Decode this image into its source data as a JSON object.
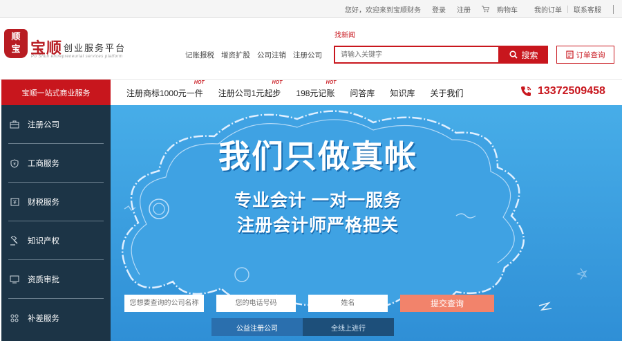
{
  "topbar": {
    "greeting": "您好，欢迎来到宝顺财务",
    "login": "登录",
    "register": "注册",
    "cart": "购物车",
    "my_orders": "我的订单",
    "contact": "联系客服"
  },
  "logo": {
    "seal_text": "顺\n宝",
    "name": "宝顺",
    "title": "创业服务平台",
    "subtitle": "Po Shun entrepreneurial services platform"
  },
  "header": {
    "hot_link": "找新闻",
    "quick_links": [
      "记账报税",
      "增资扩股",
      "公司注销",
      "注册公司"
    ],
    "search_placeholder": "请输入关键字",
    "search_button": "搜索",
    "order_query": "订单查询"
  },
  "nav": {
    "category_label": "宝顺一站式商业服务",
    "items": [
      {
        "label": "注册商标1000元一件",
        "hot": "HOT"
      },
      {
        "label": "注册公司1元起步",
        "hot": "HOT"
      },
      {
        "label": "198元记账",
        "hot": "HOT"
      },
      {
        "label": "问答库",
        "hot": ""
      },
      {
        "label": "知识库",
        "hot": ""
      },
      {
        "label": "关于我们",
        "hot": ""
      }
    ],
    "phone": "13372509458"
  },
  "sidebar": {
    "items": [
      {
        "label": "注册公司",
        "icon": "briefcase-icon"
      },
      {
        "label": "工商服务",
        "icon": "shield-icon"
      },
      {
        "label": "财税服务",
        "icon": "yen-icon"
      },
      {
        "label": "知识产权",
        "icon": "gavel-icon"
      },
      {
        "label": "资质审批",
        "icon": "monitor-icon"
      },
      {
        "label": "补差服务",
        "icon": "grid-icon"
      }
    ]
  },
  "banner": {
    "headline": "我们只做真帐",
    "subline1": "专业会计 一对一服务",
    "subline2": "注册会计师严格把关",
    "form": {
      "company_placeholder": "您想要查询的公司名称",
      "phone_placeholder": "您的电话号码",
      "name_placeholder": "姓名",
      "submit": "提交查询"
    },
    "tabs": [
      "公益注册公司",
      "全线上进行"
    ]
  },
  "colors": {
    "brand_red": "#c8161d",
    "sidebar_bg": "#1c3446",
    "banner_bg": "#3b9fe0",
    "submit_bg": "#f2836b"
  }
}
